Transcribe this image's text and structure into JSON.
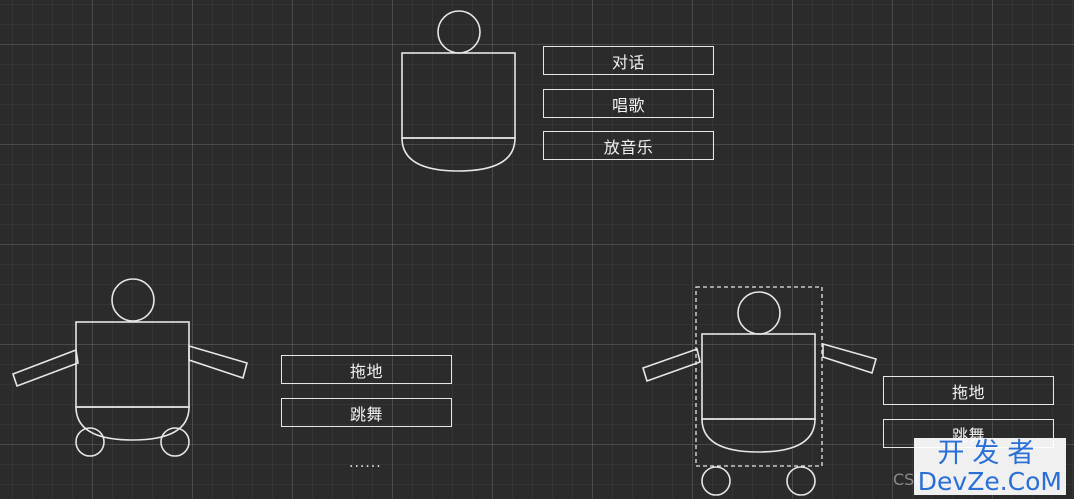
{
  "robot_top": {
    "buttons": [
      "对话",
      "唱歌",
      "放音乐"
    ]
  },
  "robot_left": {
    "buttons": [
      "拖地",
      "跳舞"
    ],
    "more": "......"
  },
  "robot_right": {
    "buttons": [
      "拖地",
      "跳舞"
    ],
    "more": "......"
  },
  "watermark": {
    "top": "开发者",
    "bottom": "DevZe.CoM",
    "csdn": "CSDN"
  }
}
